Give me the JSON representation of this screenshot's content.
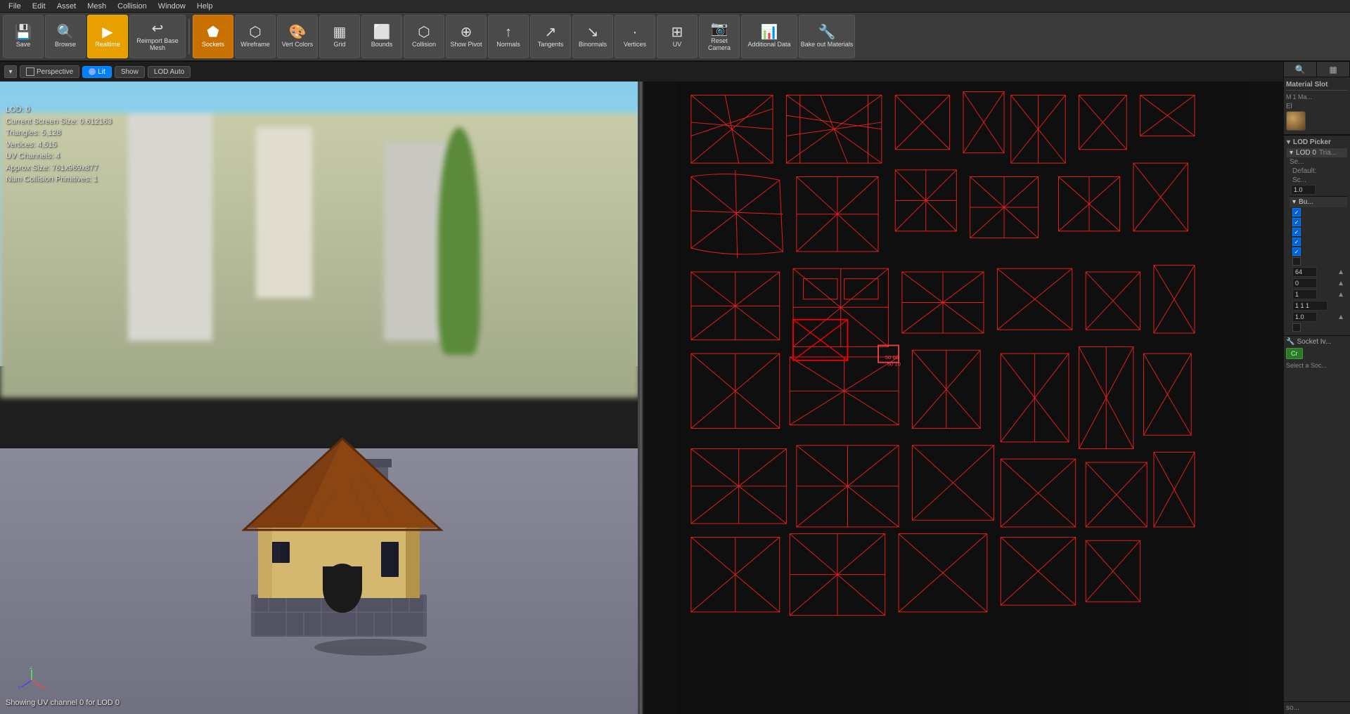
{
  "menubar": {
    "items": [
      "File",
      "Edit",
      "Asset",
      "Mesh",
      "Collision",
      "Window",
      "Help"
    ]
  },
  "toolbar": {
    "buttons": [
      {
        "id": "save",
        "label": "Save",
        "icon": "💾",
        "active": false,
        "wide": false
      },
      {
        "id": "browse",
        "label": "Browse",
        "icon": "🔍",
        "active": false,
        "wide": false
      },
      {
        "id": "realtime",
        "label": "Realtime",
        "icon": "▶",
        "active": true,
        "wide": false
      },
      {
        "id": "reimport-base-mesh",
        "label": "Reimport Base Mesh",
        "icon": "↩",
        "active": false,
        "wide": true
      },
      {
        "id": "sockets",
        "label": "Sockets",
        "icon": "⬟",
        "active": true,
        "wide": false
      },
      {
        "id": "wireframe",
        "label": "Wireframe",
        "icon": "⬡",
        "active": false,
        "wide": false
      },
      {
        "id": "vert-colors",
        "label": "Vert Colors",
        "icon": "🎨",
        "active": false,
        "wide": false
      },
      {
        "id": "grid",
        "label": "Grid",
        "icon": "▦",
        "active": false,
        "wide": false
      },
      {
        "id": "bounds",
        "label": "Bounds",
        "icon": "⬜",
        "active": false,
        "wide": false
      },
      {
        "id": "collision",
        "label": "Collision",
        "icon": "⬡",
        "active": false,
        "wide": false
      },
      {
        "id": "show-pivot",
        "label": "Show Pivot",
        "icon": "⊕",
        "active": false,
        "wide": false
      },
      {
        "id": "normals",
        "label": "Normals",
        "icon": "↑",
        "active": false,
        "wide": false
      },
      {
        "id": "tangents",
        "label": "Tangents",
        "icon": "↗",
        "active": false,
        "wide": false
      },
      {
        "id": "binormals",
        "label": "Binormals",
        "icon": "↘",
        "active": false,
        "wide": false
      },
      {
        "id": "vertices",
        "label": "Vertices",
        "icon": "·",
        "active": false,
        "wide": false
      },
      {
        "id": "uv",
        "label": "UV",
        "icon": "⊞",
        "active": false,
        "wide": false
      },
      {
        "id": "reset-camera",
        "label": "Reset Camera",
        "icon": "📷",
        "active": false,
        "wide": false
      },
      {
        "id": "additional-data",
        "label": "Additional Data",
        "icon": "📊",
        "active": false,
        "wide": false
      },
      {
        "id": "bake-out-materials",
        "label": "Bake out Materials",
        "icon": "🔧",
        "active": false,
        "wide": true
      }
    ]
  },
  "viewport": {
    "mode": "Perspective",
    "shading": "Lit",
    "show_btn": "Show",
    "lod_auto": "LOD Auto",
    "info": {
      "lod": "LOD: 0",
      "screen_size": "Current Screen Size: 0.612163",
      "triangles": "Triangles: 5,128",
      "vertices": "Vertices: 4,515",
      "uv_channels": "UV Channels: 4",
      "approx_size": "Approx Size: 761x969x877",
      "num_collision": "Num Collision Primitives: 1"
    },
    "uv_channel_info": "Showing UV channel 0 for LOD 0"
  },
  "side_panel": {
    "icons": [
      "🔍",
      "▦"
    ],
    "material_slot_title": "Material Slot",
    "material_slot_headers": [
      "M",
      "1 Ma..."
    ],
    "element_label": "El",
    "lod_picker_title": "LOD Picker",
    "lod0": {
      "label": "LOD 0",
      "triangles": "Tria..."
    },
    "properties": {
      "se_label": "Se...",
      "default_label": "Default:",
      "sc_label": "Sc...",
      "sc_value": "1.0",
      "bu_label": "Bu...",
      "checkboxes": [
        true,
        true,
        true,
        true,
        true,
        true
      ],
      "value_64": "64",
      "value_0": "0",
      "value_1": "1",
      "value_111": "1 1 1",
      "value_10": "1.0"
    },
    "socket_label": "Socket Iv...",
    "create_btn": "Cr",
    "select_socket": "Select a Soc...",
    "so_label": "so..."
  }
}
